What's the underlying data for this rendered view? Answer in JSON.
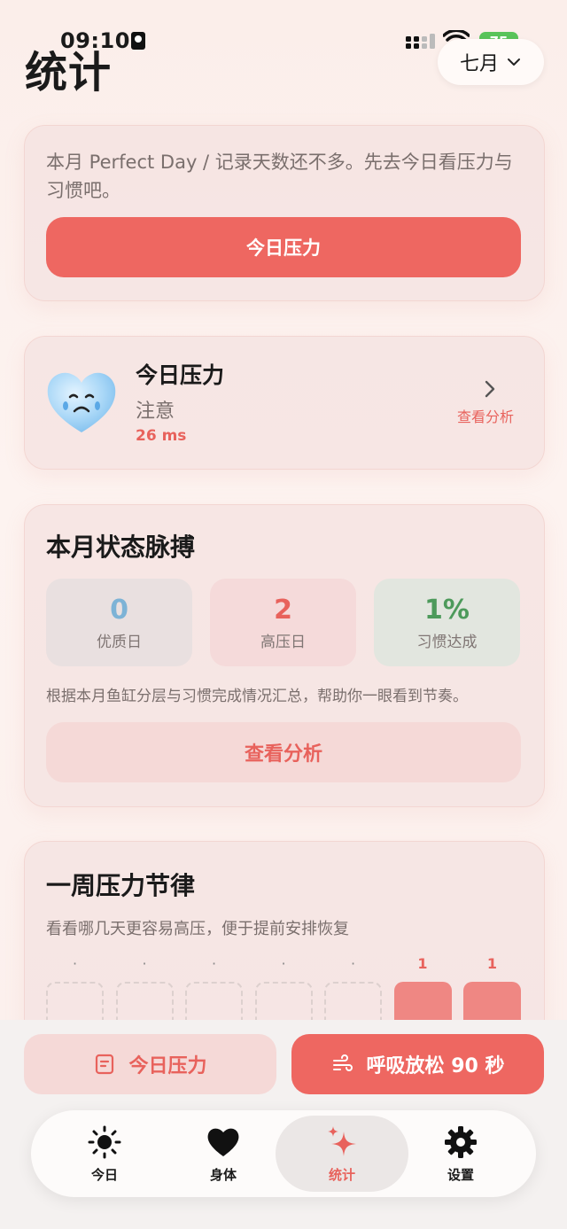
{
  "status_bar": {
    "time": "09:10",
    "battery": "75"
  },
  "header": {
    "title": "统计",
    "month": "七月"
  },
  "prompt_card": {
    "message": "本月 Perfect Day / 记录天数还不多。先去今日看压力与习惯吧。",
    "button": "今日压力"
  },
  "stress_card": {
    "title": "今日压力",
    "status": "注意",
    "value": "26 ms",
    "link": "查看分析"
  },
  "pulse_card": {
    "title": "本月状态脉搏",
    "stats": [
      {
        "value": "0",
        "label": "优质日",
        "color": "#7db3d6"
      },
      {
        "value": "2",
        "label": "高压日",
        "color": "#e8625c"
      },
      {
        "value": "1%",
        "label": "习惯达成",
        "color": "#4d9a5b"
      }
    ],
    "note": "根据本月鱼缸分层与习惯完成情况汇总，帮助你一眼看到节奏。",
    "button": "查看分析"
  },
  "week_card": {
    "title": "一周压力节律",
    "subtitle": "看看哪几天更容易高压，便于提前安排恢复",
    "days": [
      {
        "count": "·",
        "filled": false
      },
      {
        "count": "·",
        "filled": false
      },
      {
        "count": "·",
        "filled": false
      },
      {
        "count": "·",
        "filled": false
      },
      {
        "count": "·",
        "filled": false
      },
      {
        "count": "1",
        "filled": true
      },
      {
        "count": "1",
        "filled": true
      }
    ]
  },
  "actions": {
    "left": {
      "label": "今日压力",
      "icon": "journal-icon"
    },
    "right": {
      "label": "呼吸放松 90 秒",
      "icon": "wind-icon"
    }
  },
  "tabbar": {
    "items": [
      {
        "label": "今日",
        "icon": "sun-icon",
        "active": false
      },
      {
        "label": "身体",
        "icon": "heart-icon",
        "active": false
      },
      {
        "label": "统计",
        "icon": "sparkle-icon",
        "active": true
      },
      {
        "label": "设置",
        "icon": "gear-icon",
        "active": false
      }
    ]
  },
  "colors": {
    "accent": "#ee6761",
    "accent_text": "#e8625c"
  }
}
